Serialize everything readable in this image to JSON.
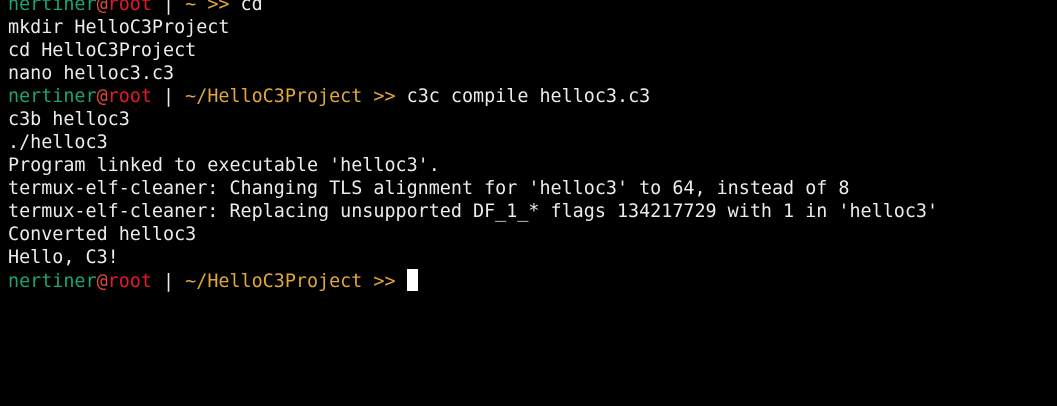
{
  "prompt": {
    "user": "nertiner",
    "at": "@",
    "host": "root",
    "separator": " | ",
    "arrow": " >> "
  },
  "lines": [
    {
      "type": "prompt",
      "path": "~",
      "command": "cd"
    },
    {
      "type": "output",
      "text": "mkdir HelloC3Project"
    },
    {
      "type": "output",
      "text": "cd HelloC3Project"
    },
    {
      "type": "output",
      "text": "nano helloc3.c3"
    },
    {
      "type": "prompt",
      "path": "~/HelloC3Project",
      "command": "c3c compile helloc3.c3"
    },
    {
      "type": "output",
      "text": "c3b helloc3"
    },
    {
      "type": "output",
      "text": "./helloc3"
    },
    {
      "type": "output",
      "text": "Program linked to executable 'helloc3'."
    },
    {
      "type": "output",
      "text": "termux-elf-cleaner: Changing TLS alignment for 'helloc3' to 64, instead of 8"
    },
    {
      "type": "output",
      "text": "termux-elf-cleaner: Replacing unsupported DF_1_* flags 134217729 with 1 in 'helloc3'"
    },
    {
      "type": "output",
      "text": "Converted helloc3"
    },
    {
      "type": "output",
      "text": "Hello, C3!"
    },
    {
      "type": "prompt",
      "path": "~/HelloC3Project",
      "command": ""
    }
  ],
  "colors": {
    "background": "#000000",
    "text": "#ececec",
    "user": "#1aa37a",
    "host": "#e5192b",
    "path": "#e0a83a",
    "cursor": "#ffffff"
  }
}
